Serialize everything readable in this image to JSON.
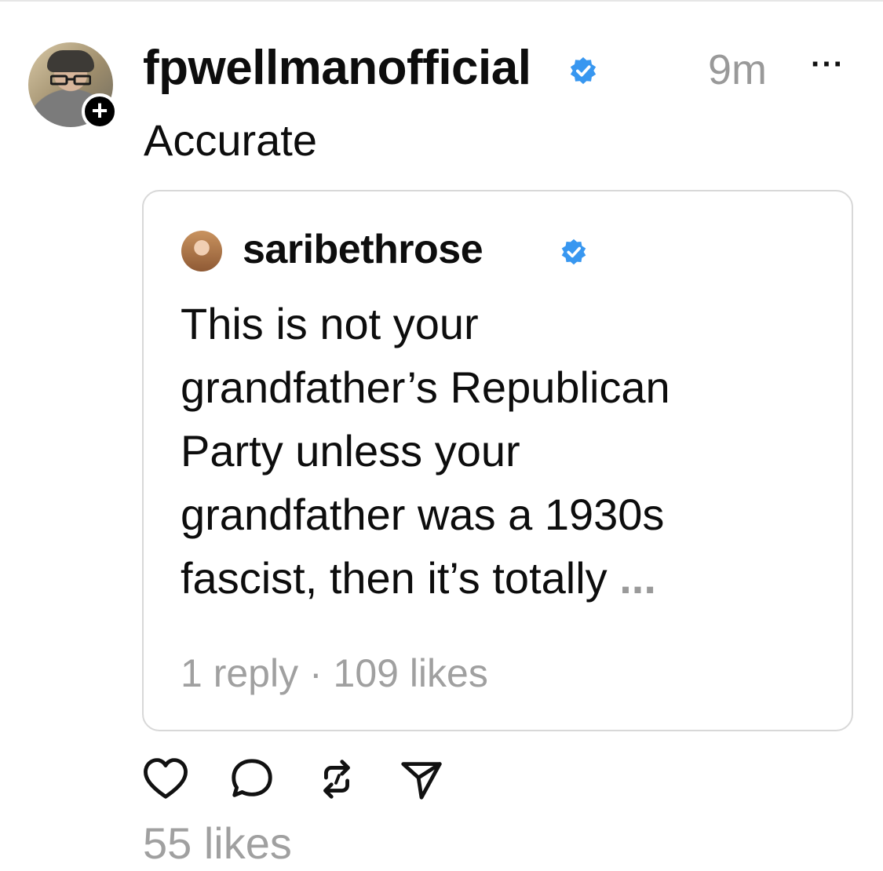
{
  "post": {
    "username": "fpwellmanofficial",
    "timestamp": "9m",
    "more_label": "···",
    "caption": "Accurate",
    "follow_label": "+",
    "likes": "55 likes"
  },
  "quote": {
    "username": "saribethrose",
    "lines": [
      "This is not your",
      "grandfather’s Republican",
      "Party unless your",
      "grandfather was a 1930s",
      "fascist, then it’s totally"
    ],
    "ellipsis": "...",
    "stats": "1 reply · 109 likes"
  },
  "colors": {
    "verified": "#3897f0",
    "muted": "#999999",
    "border": "#d8d8d8"
  },
  "icons": {
    "like": "heart-icon",
    "reply": "comment-icon",
    "repost": "repost-icon",
    "share": "send-icon"
  }
}
